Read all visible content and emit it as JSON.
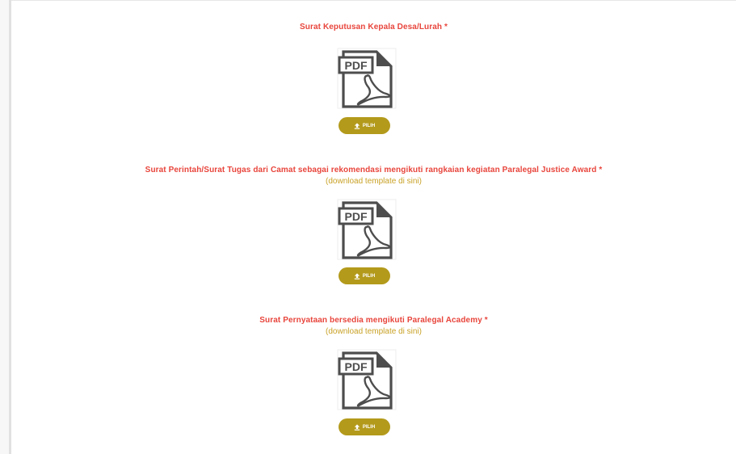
{
  "uploads": [
    {
      "title": "Surat Keputusan Kepala Desa/Lurah *",
      "icon": "pdf-file-icon",
      "icon_label": "PDF",
      "button_label": "PILIH",
      "button_icon": "upload-icon"
    },
    {
      "title": "Surat Perintah/Surat Tugas dari Camat sebagai rekomendasi mengikuti rangkaian kegiatan Paralegal Justice Award *",
      "link": "(download template di sini)",
      "icon": "pdf-file-icon",
      "icon_label": "PDF",
      "button_label": "PILIH",
      "button_icon": "upload-icon"
    },
    {
      "title": "Surat Pernyataan bersedia mengikuti Paralegal Academy *",
      "link": "(download template di sini)",
      "icon": "pdf-file-icon",
      "icon_label": "PDF",
      "button_label": "PILIH",
      "button_icon": "upload-icon"
    }
  ],
  "colors": {
    "title": "#e8453c",
    "link": "#c9a227",
    "button": "#b39a1b"
  }
}
